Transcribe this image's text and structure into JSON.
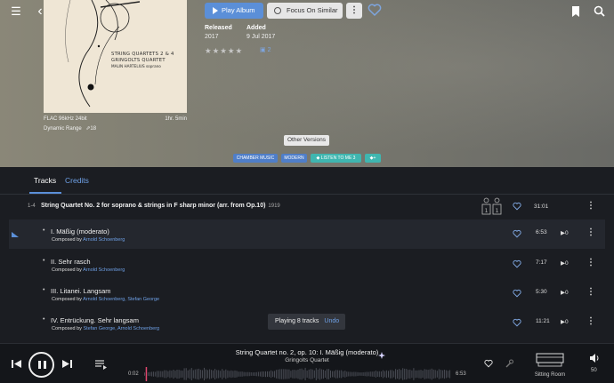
{
  "header": {
    "menu_icon": "hamburger-icon",
    "back_icon": "chevron-left-icon",
    "bookmark_icon": "bookmark-icon",
    "search_icon": "search-icon"
  },
  "album": {
    "cover_lines": [
      "STRING QUARTETS 2 & 4",
      "GRINGOLTS QUARTET",
      "MALIN HARTELIUS soprano"
    ],
    "format": "FLAC 96kHz 24bit",
    "length": "1hr. 5min",
    "dynamic_range_label": "Dynamic Range",
    "dynamic_range_value": "18",
    "play_album_label": "Play Album",
    "focus_label": "Focus On Similar",
    "more_label": "⋮",
    "released_label": "Released",
    "released_value": "2017",
    "added_label": "Added",
    "added_value": "9 Jul 2017",
    "stars": "★★★★★",
    "reviews_count": "2",
    "other_versions_label": "Other Versions",
    "tags": [
      "CHAMBER MUSIC",
      "MODERN",
      "LISTEN TO ME 3",
      "+"
    ]
  },
  "tabs": [
    {
      "label": "Tracks",
      "active": true
    },
    {
      "label": "Credits",
      "active": false
    }
  ],
  "work": {
    "range": "1-4",
    "title": "String Quartet No. 2 for soprano & strings in F sharp minor (arr. from Op.10)",
    "year": "1919",
    "duration": "31:01"
  },
  "tracks": [
    {
      "bullet": "•",
      "title": "I. Mäßig (moderato)",
      "composed_label": "Composed by",
      "composers": "Arnold Schoenberg",
      "duration": "6:53",
      "plays": "0",
      "playing": true
    },
    {
      "bullet": "•",
      "title": "II. Sehr rasch",
      "composed_label": "Composed by",
      "composers": "Arnold Schoenberg",
      "duration": "7:17",
      "plays": "0",
      "playing": false
    },
    {
      "bullet": "•",
      "title": "III. Litanei. Langsam",
      "composed_label": "Composed by",
      "composers": "Arnold Schoenberg, Stefan George",
      "duration": "5:30",
      "plays": "0",
      "playing": false
    },
    {
      "bullet": "•",
      "title": "IV. Entrückung. Sehr langsam",
      "composed_label": "Composed by",
      "composers": "Stefan George, Arnold Schoenberg",
      "duration": "11:21",
      "plays": "0",
      "playing": false
    }
  ],
  "toast": {
    "message": "Playing 8 tracks",
    "undo": "Undo"
  },
  "player": {
    "now_title": "String Quartet no. 2, op. 10: I. Mäßig (moderato)",
    "now_artist": "Gringolts Quartet",
    "time_elapsed": "0:02",
    "time_total": "6:53",
    "progress": 0.005,
    "zone_label": "Sitting Room",
    "volume": "50"
  },
  "colors": {
    "accent": "#5b8fd8",
    "link": "#6ea0e6",
    "tag_teal": "#3fb6b0",
    "background": "#1b1d22"
  }
}
